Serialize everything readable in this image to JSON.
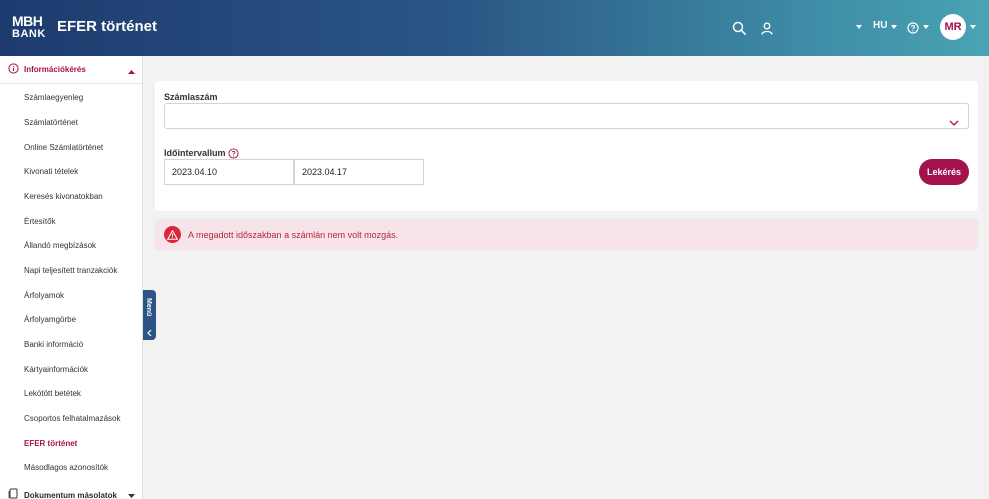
{
  "header": {
    "logo_line1": "MBH",
    "logo_line2": "BANK",
    "title": "EFER történet",
    "language": "HU",
    "avatar_initials": "MR"
  },
  "sidebar": {
    "section_info": "Információkérés",
    "items": [
      {
        "label": "Számlaegyenleg",
        "active": false
      },
      {
        "label": "Számlatörténet",
        "active": false
      },
      {
        "label": "Online Számlatörténet",
        "active": false
      },
      {
        "label": "Kivonati tételek",
        "active": false
      },
      {
        "label": "Keresés kivonatokban",
        "active": false
      },
      {
        "label": "Értesítők",
        "active": false
      },
      {
        "label": "Állandó megbízások",
        "active": false
      },
      {
        "label": "Napi teljesített tranzakciók",
        "active": false
      },
      {
        "label": "Árfolyamok",
        "active": false
      },
      {
        "label": "Árfolyamgörbe",
        "active": false
      },
      {
        "label": "Banki információ",
        "active": false
      },
      {
        "label": "Kártyainformációk",
        "active": false
      },
      {
        "label": "Lekötött betétek",
        "active": false
      },
      {
        "label": "Csoportos felhatalmazások",
        "active": false
      },
      {
        "label": "EFER történet",
        "active": true
      },
      {
        "label": "Másodlagos azonosítók",
        "active": false
      }
    ],
    "section_docs": "Dokumentum másolatok",
    "menu_tab": "Menü"
  },
  "form": {
    "account_label": "Számlaszám",
    "account_value": "",
    "interval_label": "Időintervallum",
    "date_from": "2023.04.10",
    "date_to": "2023.04.17",
    "submit_label": "Lekérés"
  },
  "alert": {
    "message": "A megadott időszakban a számlán nem volt mozgás."
  },
  "colors": {
    "brand": "#a3124c",
    "header_start": "#1d3b6e",
    "header_end": "#4aa3b3",
    "alert_bg": "#f6e4e8",
    "alert_icon": "#d8263c"
  }
}
